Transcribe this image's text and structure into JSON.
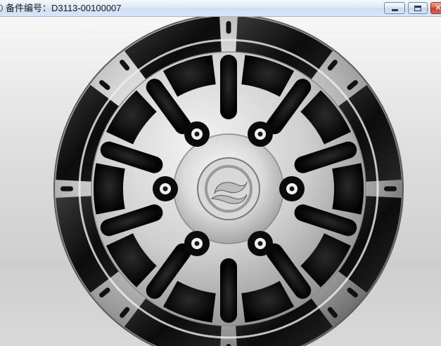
{
  "window": {
    "title": "备件编号：D3113-00100007",
    "controls": {
      "minimize": "minimize",
      "maximize": "maximize",
      "close": "✕"
    }
  },
  "viewer": {
    "subject": "wheel-rim",
    "colors": {
      "rim_silver": "#c9c9c9",
      "rim_dark": "#101010",
      "background_top": "#f7f7f7",
      "background_bottom": "#cfcfcf"
    }
  }
}
